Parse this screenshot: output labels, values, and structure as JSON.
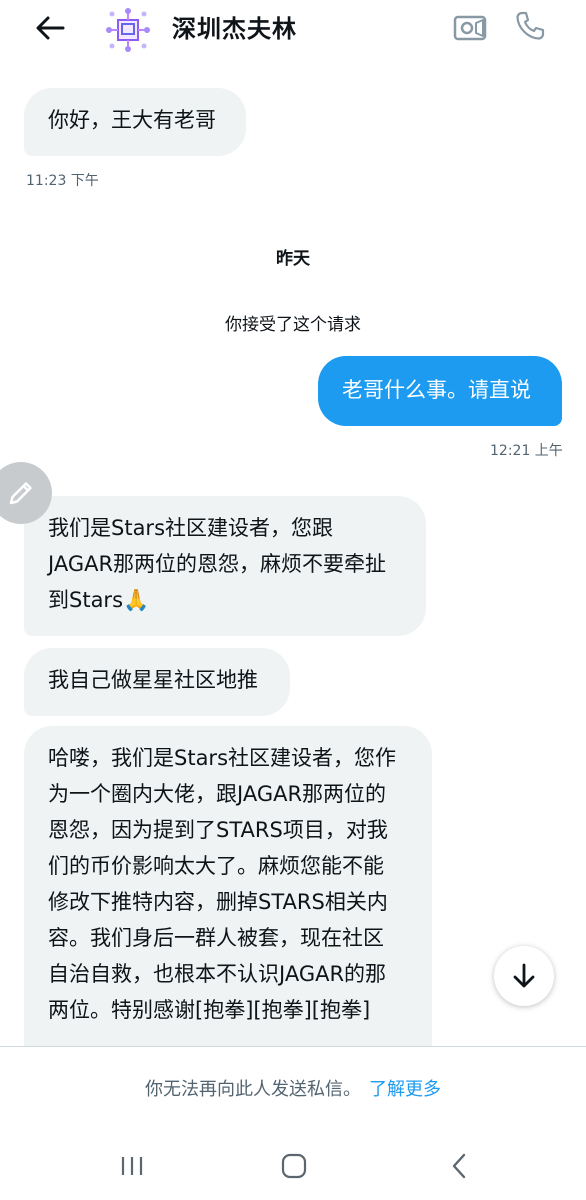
{
  "header": {
    "title": "深圳杰夫林",
    "back_icon": "arrow-left-icon",
    "avatar_icon": "app-logo-icon",
    "video_icon": "video-camera-icon",
    "call_icon": "phone-icon"
  },
  "messages": [
    {
      "direction": "in",
      "text": "你好，王大有老哥"
    },
    {
      "direction": "out",
      "text": "老哥什么事。请直说"
    },
    {
      "direction": "in",
      "text": "我们是Stars社区建设者，您跟\nJAGAR那两位的恩怨，麻烦不要牵扯\n到Stars🙏"
    },
    {
      "direction": "in",
      "text": "我自己做星星社区地推"
    },
    {
      "direction": "in",
      "text": "哈喽，我们是Stars社区建设者，您作\n为一个圈内大佬，跟JAGAR那两位的\n恩怨，因为提到了STARS项目，对我\n们的币价影响太大了。麻烦您能不能\n修改下推特内容，删掉STARS相关内\n容。我们身后一群人被套，现在社区\n自治自救，也根本不认识JAGAR的那\n两位。特别感谢[抱拳][抱拳][抱拳]"
    }
  ],
  "timestamps": {
    "first": "11:23 下午",
    "second": "12:21 上午"
  },
  "date_divider": "昨天",
  "system_note": "你接受了这个请求",
  "footer": {
    "notice": "你无法再向此人发送私信。",
    "link": "了解更多"
  },
  "floating": {
    "edit_icon": "pencil-icon",
    "scroll_icon": "arrow-down-icon"
  },
  "navbar": {
    "recents_icon": "recent-apps-icon",
    "home_icon": "home-icon",
    "back_icon": "nav-back-icon"
  },
  "colors": {
    "accent": "#1d9bf0",
    "bubble_incoming": "#eff3f4",
    "muted_text": "#536471"
  }
}
